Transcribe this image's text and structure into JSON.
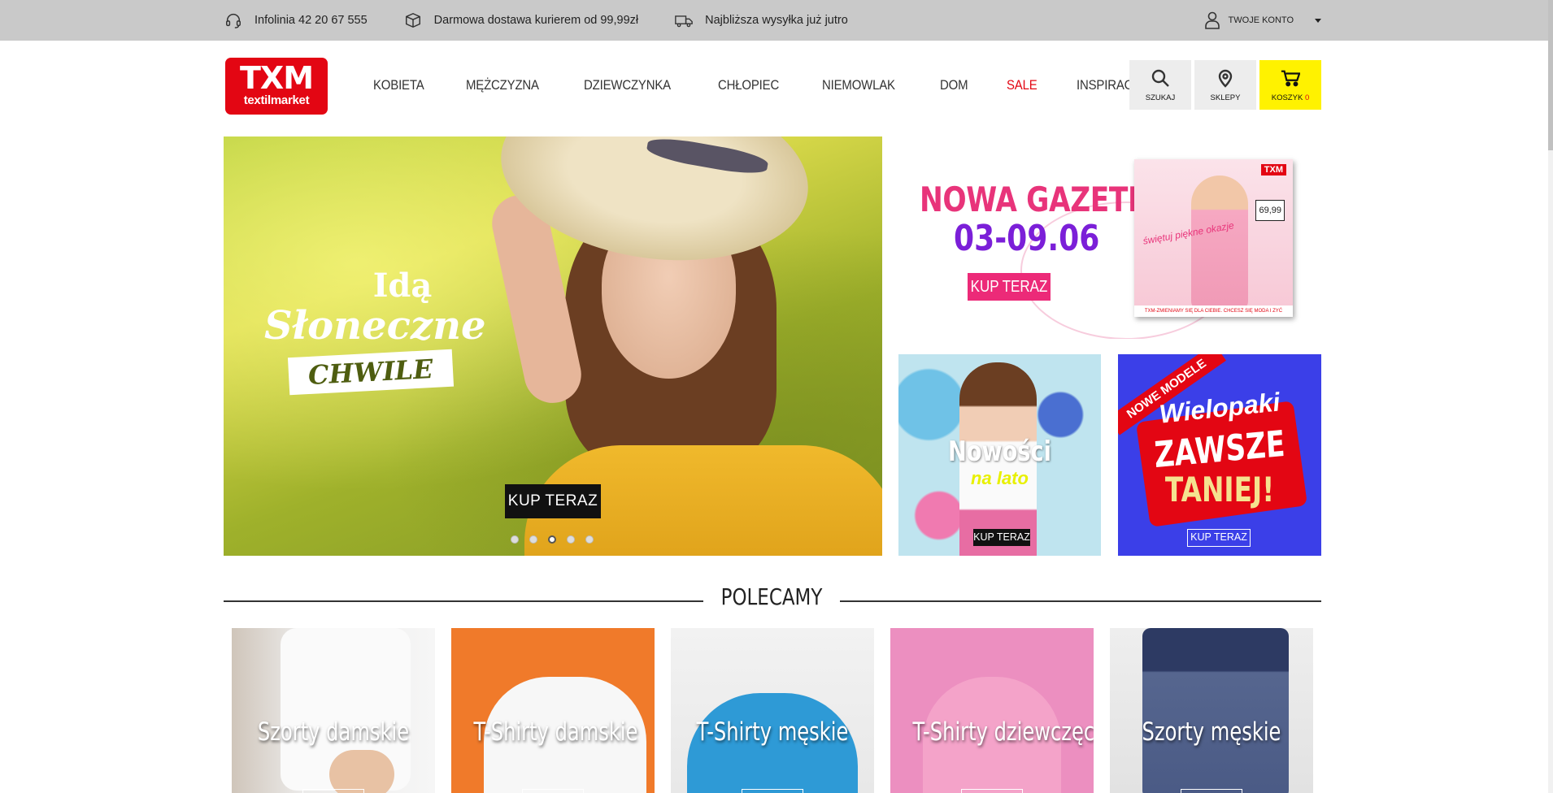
{
  "topbar": {
    "hotline": "Infolinia 42 20 67 555",
    "delivery": "Darmowa dostawa kurierem od 99,99zł",
    "shipping": "Najbliższa wysyłka już jutro",
    "account": "TWOJE KONTO"
  },
  "logo": {
    "brand": "TXM",
    "sub": "textilmarket"
  },
  "nav": [
    "KOBIETA",
    "MĘŻCZYZNA",
    "DZIEWCZYNKA",
    "CHŁOPIEC",
    "NIEMOWLAK",
    "DOM",
    "SALE",
    "INSPIRACJE"
  ],
  "header_buttons": {
    "search": "SZUKAJ",
    "stores": "SKLEPY",
    "cart": "KOSZYK",
    "cart_count": "0"
  },
  "hero": {
    "line1": "Idą",
    "line2": "Słoneczne",
    "line3": "CHWILE",
    "cta": "KUP TERAZ",
    "slides": 5,
    "active_slide": 3
  },
  "gazetka": {
    "title": "NOWA GAZETKA",
    "dates": "03-09.06",
    "cta": "KUP TERAZ",
    "mag_brand": "TXM",
    "mag_price": "69,99",
    "mag_text": "świętuj piękne okazje",
    "mag_footer": "TXM-ZMIENIAMY SIĘ DLA CIEBIE. CHCESZ SIĘ MODA I ZYĆ"
  },
  "banner_new": {
    "title": "Nowości",
    "subtitle": "na lato",
    "cta": "KUP TERAZ"
  },
  "banner_packs": {
    "ribbon": "NOWE MODELE",
    "line1": "Wielopaki",
    "line2": "ZAWSZE",
    "line3": "TANIEJ!",
    "cta": "KUP TERAZ"
  },
  "section": {
    "title": "POLECAMY"
  },
  "products": [
    "Szorty damskie",
    "T-Shirty damskie",
    "T-Shirty męskie",
    "T-Shirty dziewczęce",
    "Szorty męskie"
  ],
  "colors": {
    "brand_red": "#e30613",
    "cart_yellow": "#fff200",
    "topbar_gray": "#c9c9c9"
  }
}
